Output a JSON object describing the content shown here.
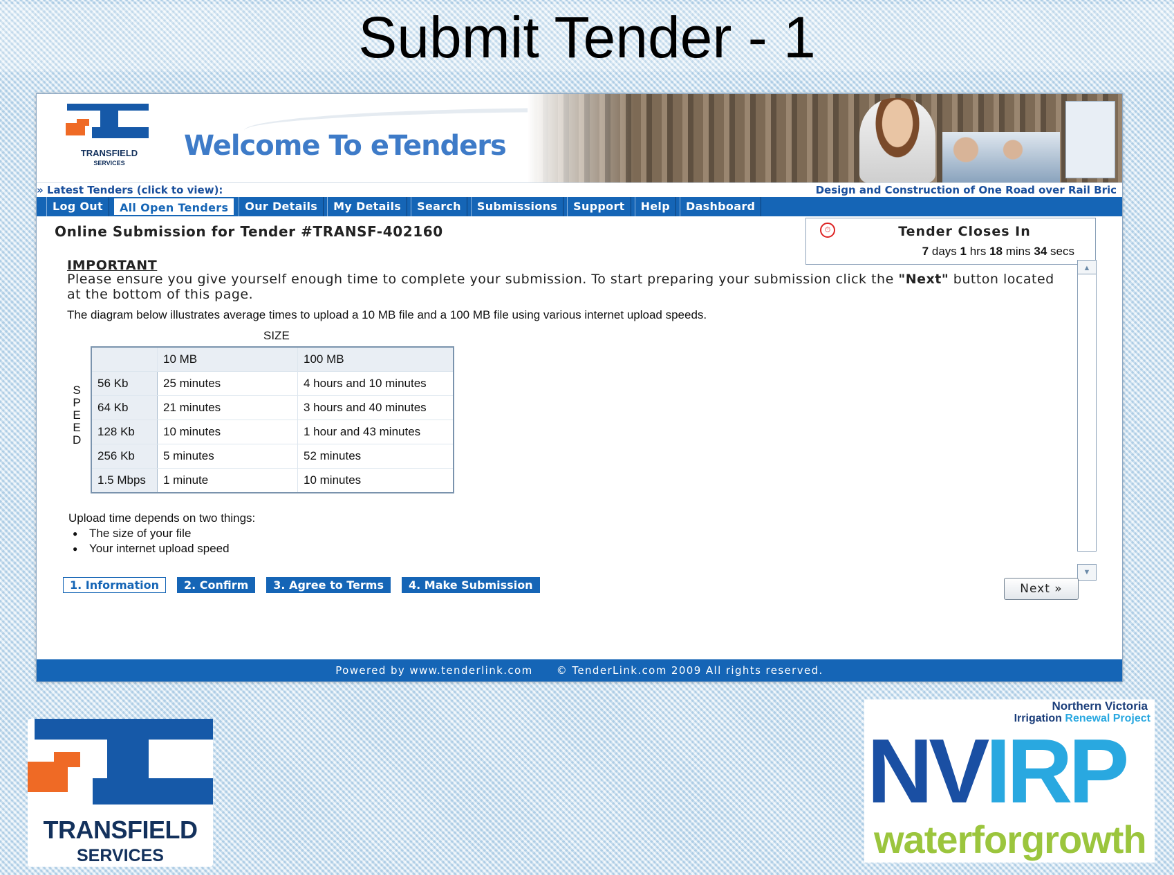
{
  "slide": {
    "title": "Submit Tender - 1"
  },
  "banner": {
    "logo_line1": "TRANSFIELD",
    "logo_line2": "SERVICES",
    "welcome": "Welcome To eTenders"
  },
  "latest": {
    "label": "» Latest Tenders (click to view):",
    "ticker": "Design and Construction of One Road over Rail Bric"
  },
  "nav": {
    "items": [
      "Log Out",
      "All Open Tenders",
      "Our Details",
      "My Details",
      "Search",
      "Submissions",
      "Support",
      "Help",
      "Dashboard"
    ]
  },
  "submission": {
    "title": "Online Submission for Tender #TRANSF-402160",
    "closes_label": "Tender Closes In",
    "countdown": {
      "days": "7",
      "days_u": "days",
      "hrs": "1",
      "hrs_u": "hrs",
      "mins": "18",
      "mins_u": "mins",
      "secs": "34",
      "secs_u": "secs"
    }
  },
  "important": {
    "heading": "IMPORTANT",
    "text1": "Please ensure you give yourself enough time to complete your submission. To start preparing your submission click the ",
    "text_bold": "\"Next\"",
    "text2": " button located at the bottom of this page."
  },
  "diagram": {
    "intro": "The diagram below illustrates average times to upload a 10 MB file and a 100 MB file using various internet upload speeds.",
    "size_label": "SIZE",
    "speed_label": [
      "S",
      "P",
      "E",
      "E",
      "D"
    ],
    "headers": [
      "",
      "10 MB",
      "100 MB"
    ],
    "rows": [
      [
        "56 Kb",
        "25 minutes",
        "4 hours and 10 minutes"
      ],
      [
        "64 Kb",
        "21 minutes",
        "3 hours and 40 minutes"
      ],
      [
        "128 Kb",
        "10 minutes",
        "1 hour and 43 minutes"
      ],
      [
        "256 Kb",
        "5 minutes",
        "52 minutes"
      ],
      [
        "1.5 Mbps",
        "1 minute",
        "10 minutes"
      ]
    ]
  },
  "notes": {
    "lead": "Upload time depends on two things:",
    "bullets": [
      "The size of your file",
      "Your internet upload speed"
    ]
  },
  "steps": [
    "1. Information",
    "2. Confirm",
    "3. Agree to Terms",
    "4. Make Submission"
  ],
  "next_label": "Next »",
  "footer": {
    "powered": "Powered by www.tenderlink.com",
    "copyright": "© TenderLink.com 2009 All rights reserved."
  },
  "logos": {
    "transfield_line1": "TRANSFIELD",
    "transfield_line2": "SERVICES",
    "nvirp_line1": "Northern Victoria",
    "nvirp_line2a": "Irrigation",
    "nvirp_line2b": " Renewal Project",
    "nvirp_nv": "NV",
    "nvirp_rp": "IRP",
    "nvirp_slogan": "waterforgrowth"
  },
  "colors": {
    "brand_blue": "#1565b6",
    "brand_orange": "#ef6a25",
    "nvirp_green": "#9bc53d",
    "nvirp_lightblue": "#29a8e0"
  }
}
